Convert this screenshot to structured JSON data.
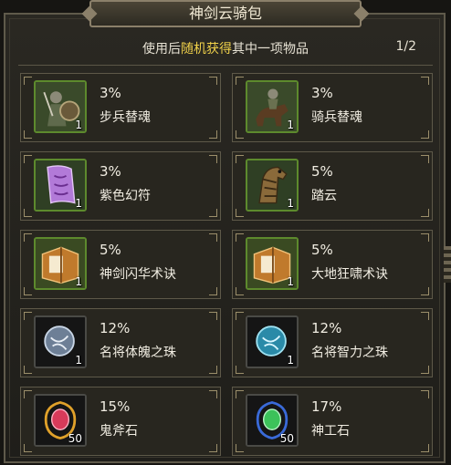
{
  "dialog": {
    "title": "神剑云骑包",
    "hint_prefix": "使用后",
    "hint_highlight": "随机获得",
    "hint_suffix": "其中一项物品",
    "page": "1/2"
  },
  "items": [
    {
      "percent": "3%",
      "name": "步兵替魂",
      "qty": "1",
      "icon": "infantry-soul-icon"
    },
    {
      "percent": "3%",
      "name": "骑兵替魂",
      "qty": "1",
      "icon": "cavalry-soul-icon"
    },
    {
      "percent": "3%",
      "name": "紫色幻符",
      "qty": "1",
      "icon": "purple-talisman-icon"
    },
    {
      "percent": "5%",
      "name": "踏云",
      "qty": "1",
      "icon": "horse-icon"
    },
    {
      "percent": "5%",
      "name": "神剑闪华术诀",
      "qty": "1",
      "icon": "skill-book-icon"
    },
    {
      "percent": "5%",
      "name": "大地狂啸术诀",
      "qty": "1",
      "icon": "skill-book-icon"
    },
    {
      "percent": "12%",
      "name": "名将体魄之珠",
      "qty": "1",
      "icon": "silver-orb-icon"
    },
    {
      "percent": "12%",
      "name": "名将智力之珠",
      "qty": "1",
      "icon": "cyan-orb-icon"
    },
    {
      "percent": "15%",
      "name": "鬼斧石",
      "qty": "50",
      "icon": "red-gem-icon"
    },
    {
      "percent": "17%",
      "name": "神工石",
      "qty": "50",
      "icon": "green-gem-icon"
    }
  ]
}
